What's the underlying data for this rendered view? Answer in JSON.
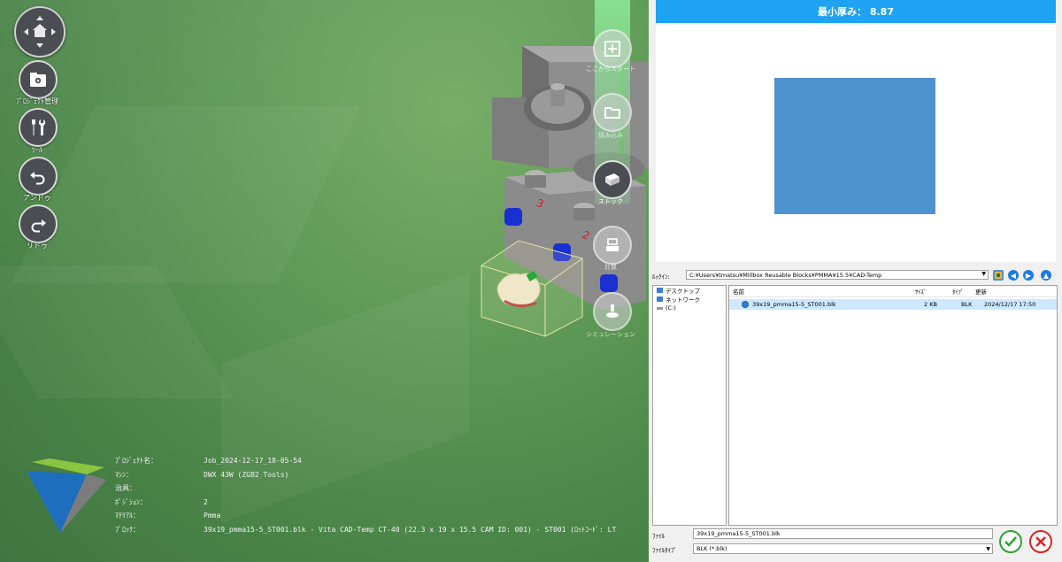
{
  "viewport": {
    "nav_labels": {
      "project": "ﾌﾟﾛｼﾞｪｸﾄ管理",
      "tool": "ﾂｰﾙ",
      "undo": "アンドゥ",
      "redo": "リドゥ"
    },
    "tool_labels": {
      "start_here": "ここからスタート",
      "load": "読み込み",
      "stock": "ストック",
      "calc": "計算",
      "simulation": "シミュレーション"
    },
    "stock_markers": [
      "3",
      "2"
    ],
    "info": [
      {
        "key": "ﾌﾟﾛｼﾞｪｸﾄ名：",
        "value": "Job_2024-12-17_18-05-54"
      },
      {
        "key": "ﾏｼﾝ：",
        "value": "DWX 43W (ZGB2 Tools)"
      },
      {
        "key": "治具：",
        "value": ""
      },
      {
        "key": "ﾎﾟｼﾞｼｮﾝ：",
        "value": "2"
      },
      {
        "key": "ﾏﾃﾘｱﾙ：",
        "value": "Pmma"
      },
      {
        "key": "ﾌﾞﾛｯｸ：",
        "value": "39x19_pmma15-5_ST001.blk - Vita CAD-Temp CT-40 (22.3 x 19 x 15.5 CAM ID: 001) - ST001 (ﾛｯﾄｺｰﾄﾞ: LT"
      }
    ]
  },
  "right_panel": {
    "thickness_label": "最小厚み： 8.87",
    "dialog": {
      "look_in_label": "ﾙｯｸｲﾝ:",
      "path": "C:¥Users¥tmatsu¥Millbox Reusable Blocks¥PMMA¥15.5¥CAD-Temp",
      "tree_items": [
        "デスクトップ",
        "ネットワーク",
        "(C:)"
      ],
      "columns": {
        "name": "名前",
        "size": "ｻｲｽﾞ",
        "type": "ﾀｲﾌﾟ",
        "date": "更新"
      },
      "files": [
        {
          "name": "39x19_pmma15-5_ST001.blk",
          "size": "2 KB",
          "type": "BLK",
          "date": "2024/12/17 17:50"
        }
      ],
      "filename_label": "ﾌｧｲﾙ",
      "filename_value": "39x19_pmma15-5_ST001.blk",
      "filetype_label": "ﾌｧｲﾙﾀｲﾌﾟ",
      "filetype_value": "BLK (*.blk)"
    }
  },
  "colors": {
    "header_blue": "#1ea2f2",
    "stock_blue": "#4f92d0",
    "ok_green": "#2aa52a",
    "cancel_red": "#dd2222"
  }
}
